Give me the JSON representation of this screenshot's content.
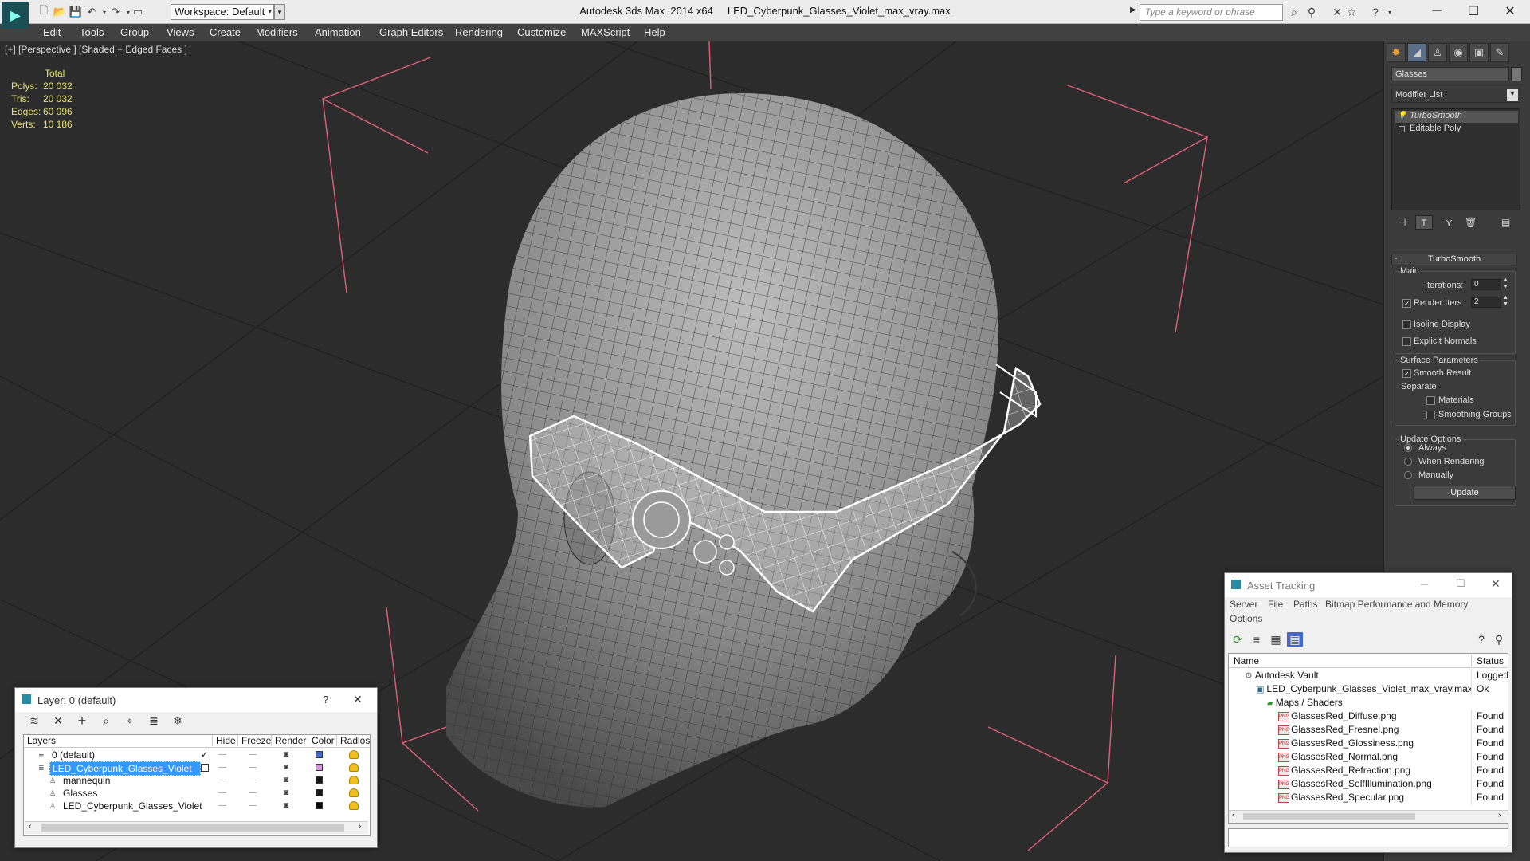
{
  "app": {
    "window_title": "Autodesk 3ds Max  2014 x64     LED_Cyberpunk_Glasses_Violet_max_vray.max",
    "workspace_label": "Workspace: Default",
    "search_placeholder": "Type a keyword or phrase"
  },
  "menu": [
    "Edit",
    "Tools",
    "Group",
    "Views",
    "Create",
    "Modifiers",
    "Animation",
    "Graph Editors",
    "Rendering",
    "Customize",
    "MAXScript",
    "Help"
  ],
  "viewport": {
    "label": "[+] [Perspective ] [Shaded + Edged Faces ]",
    "stats": {
      "header": "Total",
      "rows": [
        {
          "label": "Polys:",
          "value": "20 032"
        },
        {
          "label": "Tris:",
          "value": "20 032"
        },
        {
          "label": "Edges:",
          "value": "60 096"
        },
        {
          "label": "Verts:",
          "value": "10 186"
        }
      ]
    }
  },
  "command_panel": {
    "object_name": "Glasses",
    "modifier_list": "Modifier List",
    "stack": [
      "TurboSmooth",
      "Editable Poly"
    ],
    "rollout_title": "TurboSmooth",
    "main_label": "Main",
    "iterations_label": "Iterations:",
    "iterations_value": "0",
    "render_iters_label": "Render Iters:",
    "render_iters_value": "2",
    "isoline_label": "Isoline Display",
    "explicit_normals_label": "Explicit Normals",
    "surface_params_label": "Surface Parameters",
    "smooth_result_label": "Smooth Result",
    "separate_label": "Separate",
    "materials_label": "Materials",
    "smoothing_groups_label": "Smoothing Groups",
    "update_options_label": "Update Options",
    "always_label": "Always",
    "when_rendering_label": "When Rendering",
    "manually_label": "Manually",
    "update_button": "Update"
  },
  "layer_dialog": {
    "title": "Layer: 0 (default)",
    "help": "?",
    "close": "✕",
    "columns": [
      "Layers",
      "Hide",
      "Freeze",
      "Render",
      "Color",
      "Radios"
    ],
    "rows": [
      {
        "name": "0 (default)",
        "color": "#3a6ad8",
        "selected": false,
        "indent": 1
      },
      {
        "name": "LED_Cyberpunk_Glasses_Violet",
        "color": "#d890e0",
        "selected": true,
        "indent": 1
      },
      {
        "name": "mannequin",
        "color": "#1a1a1a",
        "selected": false,
        "indent": 2
      },
      {
        "name": "Glasses",
        "color": "#1a1a1a",
        "selected": false,
        "indent": 2
      },
      {
        "name": "LED_Cyberpunk_Glasses_Violet",
        "color": "#0a0a0a",
        "selected": false,
        "indent": 2
      }
    ]
  },
  "asset_tracking": {
    "title": "Asset Tracking",
    "menu": [
      "Server",
      "File",
      "Paths",
      "Bitmap Performance and Memory"
    ],
    "menu2": "Options",
    "columns": [
      "Name",
      "Status"
    ],
    "rows": [
      {
        "name": "Autodesk Vault",
        "status": "Logged O",
        "indent": 1,
        "icon": "vault"
      },
      {
        "name": "LED_Cyberpunk_Glasses_Violet_max_vray.max",
        "status": "Ok",
        "indent": 2,
        "icon": "max"
      },
      {
        "name": "Maps / Shaders",
        "status": "",
        "indent": 3,
        "icon": "maps"
      },
      {
        "name": "GlassesRed_Diffuse.png",
        "status": "Found",
        "indent": 4,
        "icon": "png"
      },
      {
        "name": "GlassesRed_Fresnel.png",
        "status": "Found",
        "indent": 4,
        "icon": "png"
      },
      {
        "name": "GlassesRed_Glossiness.png",
        "status": "Found",
        "indent": 4,
        "icon": "png"
      },
      {
        "name": "GlassesRed_Normal.png",
        "status": "Found",
        "indent": 4,
        "icon": "png"
      },
      {
        "name": "GlassesRed_Refraction.png",
        "status": "Found",
        "indent": 4,
        "icon": "png"
      },
      {
        "name": "GlassesRed_SelfIllumination.png",
        "status": "Found",
        "indent": 4,
        "icon": "png"
      },
      {
        "name": "GlassesRed_Specular.png",
        "status": "Found",
        "indent": 4,
        "icon": "png"
      }
    ]
  },
  "colors": {
    "viewport_bg": "#2c2c2c",
    "stats_text": "#e8e070",
    "bbox_pink": "#e0607a",
    "selection_blue": "#3399ff"
  }
}
